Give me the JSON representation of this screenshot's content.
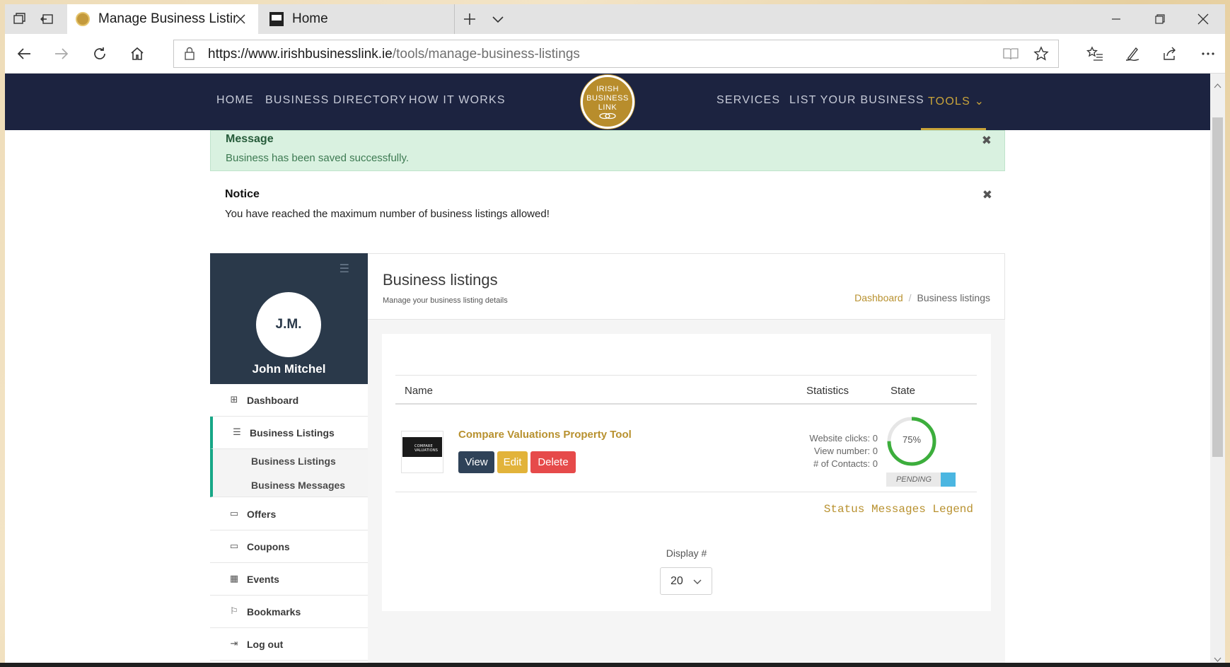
{
  "browser": {
    "tabs": [
      {
        "title": "Manage Business Listing",
        "active": true
      },
      {
        "title": "Home",
        "active": false
      }
    ],
    "url_host": "https://www.irishbusinesslink.ie",
    "url_path": "/tools/manage-business-listings"
  },
  "site": {
    "menu_left": [
      "HOME",
      "BUSINESS DIRECTORY",
      "HOW IT WORKS"
    ],
    "menu_right": [
      "SERVICES",
      "LIST YOUR BUSINESS",
      "TOOLS ⌄"
    ],
    "logo_lines": [
      "IRISH",
      "BUSINESS",
      "LINK"
    ],
    "accent": "#c9a43a",
    "header_bg": "#1c2340"
  },
  "alerts": {
    "success": {
      "title": "Message",
      "text": "Business has been saved successfully."
    },
    "notice": {
      "title": "Notice",
      "text": "You have reached the maximum number of business listings allowed!"
    }
  },
  "sidebar": {
    "initials": "J.M.",
    "name": "John Mitchel",
    "items": [
      {
        "label": "Dashboard",
        "icon": "grid-icon"
      },
      {
        "label": "Business Listings",
        "icon": "list-icon"
      },
      {
        "label": "Offers",
        "icon": "offers-icon"
      },
      {
        "label": "Coupons",
        "icon": "ticket-icon"
      },
      {
        "label": "Events",
        "icon": "calendar-icon"
      },
      {
        "label": "Bookmarks",
        "icon": "bookmark-icon"
      },
      {
        "label": "Log out",
        "icon": "logout-icon"
      }
    ],
    "sub_items": [
      "Business Listings",
      "Business Messages"
    ]
  },
  "main": {
    "title": "Business listings",
    "subtitle": "Manage your business listing details",
    "breadcrumb": [
      "Dashboard",
      "Business listings"
    ],
    "columns": [
      "Name",
      "Statistics",
      "State"
    ],
    "listing": {
      "thumb_text": "COMPARE VALUATIONS",
      "name": "Compare Valuations Property Tool",
      "buttons": [
        "View",
        "Edit",
        "Delete"
      ],
      "stats": [
        "Website clicks: 0",
        "View number: 0",
        "# of Contacts: 0"
      ],
      "completion": "75%",
      "completion_value": 75,
      "state": "PENDING"
    },
    "legend_link": "Status Messages Legend",
    "display_label": "Display #",
    "display_value": "20"
  }
}
